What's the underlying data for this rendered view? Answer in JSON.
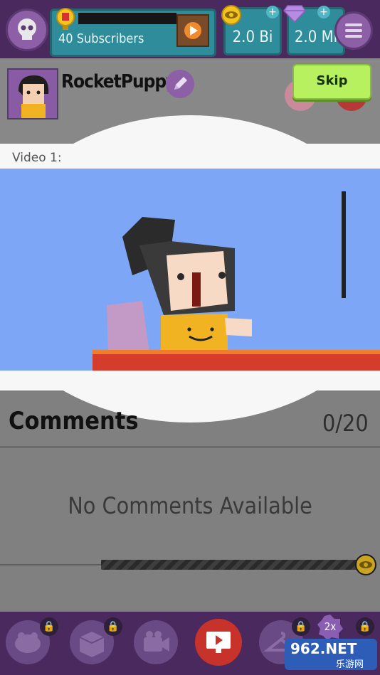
{
  "header": {
    "subscribers": "40 Subscribers",
    "views": "2.0 Bi",
    "gems": "2.0 Mi"
  },
  "profile": {
    "username": "RocketPuppy",
    "skip_label": "Skip"
  },
  "video": {
    "label": "Video 1:"
  },
  "comments": {
    "title": "Comments",
    "count": "0/20",
    "empty_message": "No Comments Available",
    "progress_fraction": 1.0
  },
  "bottom_nav": {
    "multiplier_badge": "2x"
  },
  "watermark": {
    "brand": "962.NET",
    "sub": "乐游网"
  },
  "colors": {
    "top_bar": "#4a2a5e",
    "skip_button": "#b7f15f",
    "video_bg": "#7da6f7",
    "desk": "#d53c2c"
  }
}
